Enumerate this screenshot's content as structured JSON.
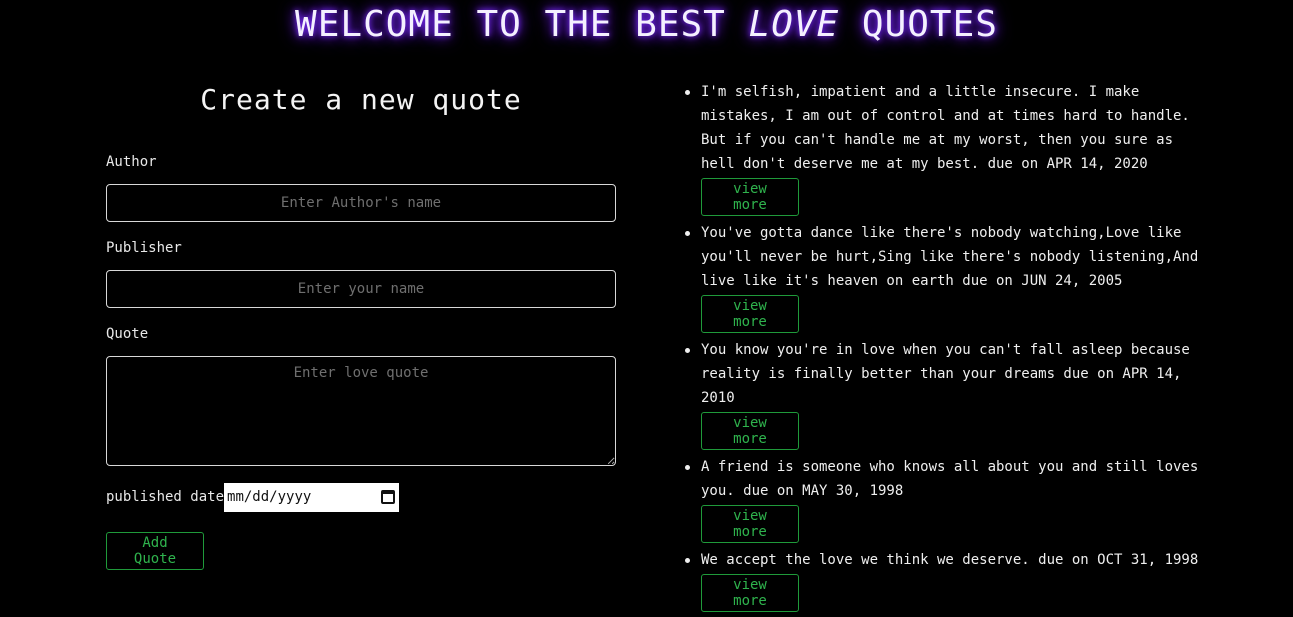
{
  "header": {
    "title_before": "WELCOME TO THE BEST ",
    "title_em": "LOVE",
    "title_after": " QUOTES"
  },
  "form": {
    "heading": "Create a new quote",
    "author_label": "Author",
    "author_placeholder": "Enter Author's name",
    "publisher_label": "Publisher",
    "publisher_placeholder": "Enter your name",
    "quote_label": "Quote",
    "quote_placeholder": "Enter love quote",
    "date_label": "published date",
    "date_value": "mm/dd/yyyy",
    "submit_label": "Add Quote"
  },
  "quotes": [
    {
      "text": "I'm selfish, impatient and a little insecure. I make mistakes, I am out of control and at times hard to handle. But if you can't handle me at my worst, then you sure as hell don't deserve me at my best. due on APR 14, 2020",
      "button": "view more"
    },
    {
      "text": "You've gotta dance like there's nobody watching,Love like you'll never be hurt,Sing like there's nobody listening,And live like it's heaven on earth due on JUN 24, 2005",
      "button": "view more"
    },
    {
      "text": "You know you're in love when you can't fall asleep because reality is finally better than your dreams due on APR 14, 2010",
      "button": "view more"
    },
    {
      "text": "A friend is someone who knows all about you and still loves you. due on MAY 30, 1998",
      "button": "view more"
    },
    {
      "text": "We accept the love we think we deserve. due on OCT 31, 1998",
      "button": "view more"
    }
  ],
  "colors": {
    "background": "#000000",
    "title_glow": "#7b2bff",
    "button_green": "#2fb34d"
  }
}
